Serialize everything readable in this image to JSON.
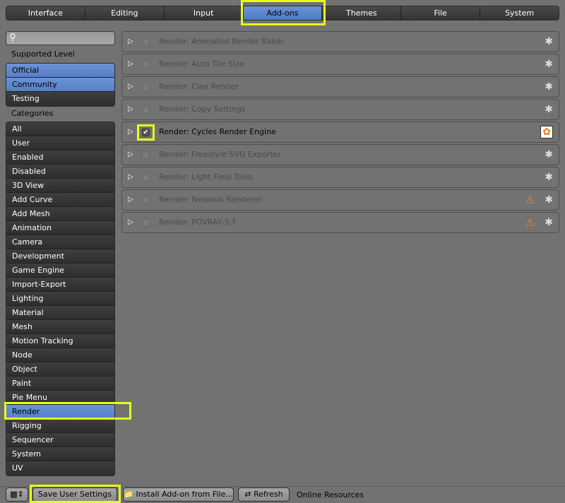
{
  "tabs": [
    "Interface",
    "Editing",
    "Input",
    "Add-ons",
    "Themes",
    "File",
    "System"
  ],
  "active_tab": "Add-ons",
  "sidebar": {
    "search_placeholder": "",
    "supported_level_label": "Supported Level",
    "levels": [
      {
        "label": "Official",
        "selected": true
      },
      {
        "label": "Community",
        "selected": true
      },
      {
        "label": "Testing",
        "selected": false
      }
    ],
    "categories_label": "Categories",
    "categories": [
      "All",
      "User",
      "Enabled",
      "Disabled",
      "3D View",
      "Add Curve",
      "Add Mesh",
      "Animation",
      "Camera",
      "Development",
      "Game Engine",
      "Import-Export",
      "Lighting",
      "Material",
      "Mesh",
      "Motion Tracking",
      "Node",
      "Object",
      "Paint",
      "Pie Menu",
      "Render",
      "Rigging",
      "Sequencer",
      "System",
      "UV"
    ],
    "selected_category": "Render"
  },
  "addons": [
    {
      "name": "Render: Animated Render Baker",
      "enabled": false,
      "warning": false,
      "icon": "community-icon"
    },
    {
      "name": "Render: Auto Tile Size",
      "enabled": false,
      "warning": false,
      "icon": "community-icon"
    },
    {
      "name": "Render: Clay Render",
      "enabled": false,
      "warning": false,
      "icon": "community-icon"
    },
    {
      "name": "Render: Copy Settings",
      "enabled": false,
      "warning": false,
      "icon": "community-icon"
    },
    {
      "name": "Render: Cycles Render Engine",
      "enabled": true,
      "warning": false,
      "icon": "official-blender-icon"
    },
    {
      "name": "Render: Freestyle SVG Exporter",
      "enabled": false,
      "warning": false,
      "icon": "community-icon"
    },
    {
      "name": "Render: Light Field Tools",
      "enabled": false,
      "warning": false,
      "icon": "community-icon"
    },
    {
      "name": "Render: Network Renderer",
      "enabled": false,
      "warning": true,
      "icon": "community-icon"
    },
    {
      "name": "Render: POVRAY-3.7",
      "enabled": false,
      "warning": true,
      "icon": "community-icon"
    }
  ],
  "footer": {
    "save": "Save User Settings",
    "install": "Install Add-on from File...",
    "refresh": "Refresh",
    "online": "Online Resources"
  }
}
